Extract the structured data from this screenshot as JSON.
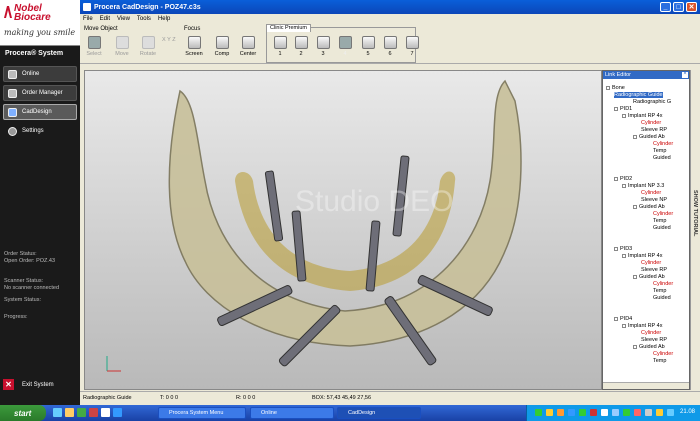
{
  "sidebar": {
    "brand": "Nobel Biocare",
    "tagline": "making you smile",
    "system_title": "Procera® System",
    "items": [
      {
        "label": "Online"
      },
      {
        "label": "Order Manager"
      },
      {
        "label": "CadDesign"
      },
      {
        "label": "Settings"
      }
    ],
    "order_status_label": "Order Status:",
    "open_order": "Open Order: POZ.43",
    "scanner_status_label": "Scanner Status:",
    "scanner_status": "No scanner connected",
    "system_status_label": "System Status:",
    "progress_label": "Progress:",
    "exit_label": "Exit System"
  },
  "window": {
    "title": "Procera CadDesign - POZ47.c3s",
    "menu": [
      "File",
      "Edit",
      "View",
      "Tools",
      "Help"
    ]
  },
  "toolbar": {
    "move_object_title": "Move Object",
    "move_object_buttons": [
      "Select",
      "Move",
      "Rotate"
    ],
    "axis_labels": "X Y Z",
    "focus_title": "Focus",
    "focus_buttons": [
      "Screen",
      "Comp",
      "Center"
    ],
    "clinic_premium_title": "Clinic Premium",
    "clinic_buttons": [
      "1",
      "2",
      "3",
      "4",
      "5",
      "6",
      "7"
    ]
  },
  "viewport": {
    "watermark": "Studio DEO"
  },
  "link_editor": {
    "title": "Link Editor",
    "tutorial_label": "SHOW TUTORIAL",
    "tree": [
      {
        "label": "Bone"
      },
      {
        "label": "Radiographic Guide",
        "selected": true
      },
      {
        "label": "Radiographic G"
      },
      {
        "label": "PID1"
      },
      {
        "label": "Implant RP 4x"
      },
      {
        "label": "Cylinder",
        "red": true
      },
      {
        "label": "Sleeve RP"
      },
      {
        "label": "Guided Ab"
      },
      {
        "label": "Cylinder",
        "red": true
      },
      {
        "label": "Temp"
      },
      {
        "label": "Guided"
      },
      {
        "label": "PID2"
      },
      {
        "label": "Implant NP 3.3"
      },
      {
        "label": "Cylinder",
        "red": true
      },
      {
        "label": "Sleeve NP"
      },
      {
        "label": "Guided Ab"
      },
      {
        "label": "Cylinder",
        "red": true
      },
      {
        "label": "Temp"
      },
      {
        "label": "Guided"
      },
      {
        "label": "PID3"
      },
      {
        "label": "Implant RP 4x"
      },
      {
        "label": "Cylinder",
        "red": true
      },
      {
        "label": "Sleeve RP"
      },
      {
        "label": "Guided Ab"
      },
      {
        "label": "Cylinder",
        "red": true
      },
      {
        "label": "Temp"
      },
      {
        "label": "Guided"
      },
      {
        "label": "PID4"
      },
      {
        "label": "Implant RP 4x"
      },
      {
        "label": "Cylinder",
        "red": true
      },
      {
        "label": "Sleeve RP"
      },
      {
        "label": "Guided Ab"
      },
      {
        "label": "Cylinder",
        "red": true
      },
      {
        "label": "Temp"
      }
    ]
  },
  "statusbar": {
    "object": "Radiographic Guide",
    "translation": "T: 0 0 0",
    "rotation": "R: 0 0 0",
    "box": "BOX: 57,43 45,49 27,56"
  },
  "taskbar": {
    "start_label": "start",
    "tasks": [
      "Procera System Menu",
      "Online",
      "CadDesign"
    ],
    "clock": "21.08"
  },
  "colors": {
    "brand_red": "#c8102e",
    "xp_blue": "#0b46b8",
    "selection": "#316ac5"
  }
}
